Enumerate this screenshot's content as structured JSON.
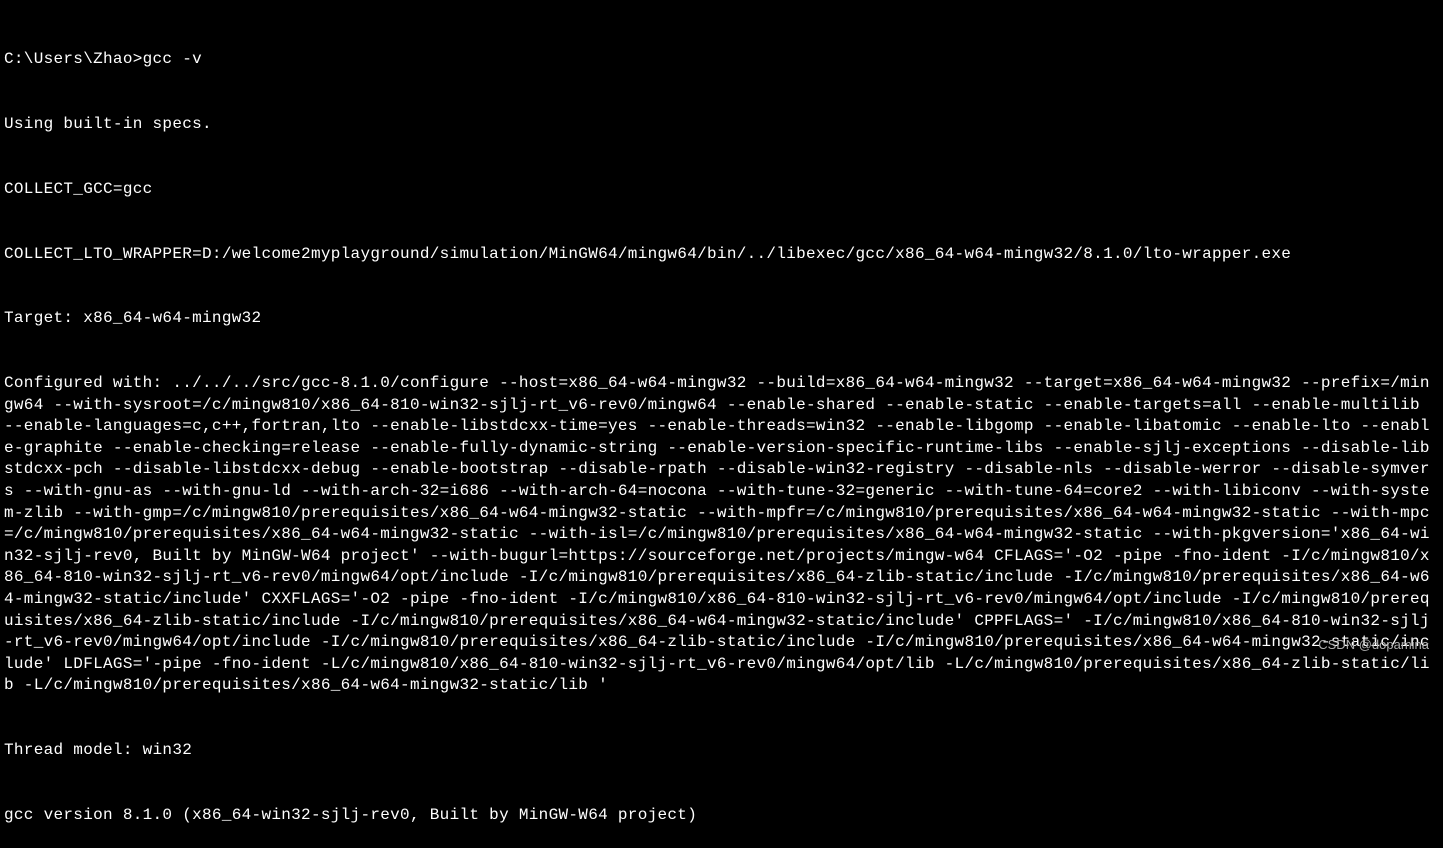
{
  "terminal": {
    "prompt": "C:\\Users\\Zhao>",
    "command": "gcc -v",
    "output_lines": [
      "Using built-in specs.",
      "COLLECT_GCC=gcc",
      "COLLECT_LTO_WRAPPER=D:/welcome2myplayground/simulation/MinGW64/mingw64/bin/../libexec/gcc/x86_64-w64-mingw32/8.1.0/lto-wrapper.exe",
      "Target: x86_64-w64-mingw32",
      "Configured with: ../../../src/gcc-8.1.0/configure --host=x86_64-w64-mingw32 --build=x86_64-w64-mingw32 --target=x86_64-w64-mingw32 --prefix=/mingw64 --with-sysroot=/c/mingw810/x86_64-810-win32-sjlj-rt_v6-rev0/mingw64 --enable-shared --enable-static --enable-targets=all --enable-multilib --enable-languages=c,c++,fortran,lto --enable-libstdcxx-time=yes --enable-threads=win32 --enable-libgomp --enable-libatomic --enable-lto --enable-graphite --enable-checking=release --enable-fully-dynamic-string --enable-version-specific-runtime-libs --enable-sjlj-exceptions --disable-libstdcxx-pch --disable-libstdcxx-debug --enable-bootstrap --disable-rpath --disable-win32-registry --disable-nls --disable-werror --disable-symvers --with-gnu-as --with-gnu-ld --with-arch-32=i686 --with-arch-64=nocona --with-tune-32=generic --with-tune-64=core2 --with-libiconv --with-system-zlib --with-gmp=/c/mingw810/prerequisites/x86_64-w64-mingw32-static --with-mpfr=/c/mingw810/prerequisites/x86_64-w64-mingw32-static --with-mpc=/c/mingw810/prerequisites/x86_64-w64-mingw32-static --with-isl=/c/mingw810/prerequisites/x86_64-w64-mingw32-static --with-pkgversion='x86_64-win32-sjlj-rev0, Built by MinGW-W64 project' --with-bugurl=https://sourceforge.net/projects/mingw-w64 CFLAGS='-O2 -pipe -fno-ident -I/c/mingw810/x86_64-810-win32-sjlj-rt_v6-rev0/mingw64/opt/include -I/c/mingw810/prerequisites/x86_64-zlib-static/include -I/c/mingw810/prerequisites/x86_64-w64-mingw32-static/include' CXXFLAGS='-O2 -pipe -fno-ident -I/c/mingw810/x86_64-810-win32-sjlj-rt_v6-rev0/mingw64/opt/include -I/c/mingw810/prerequisites/x86_64-zlib-static/include -I/c/mingw810/prerequisites/x86_64-w64-mingw32-static/include' CPPFLAGS=' -I/c/mingw810/x86_64-810-win32-sjlj-rt_v6-rev0/mingw64/opt/include -I/c/mingw810/prerequisites/x86_64-zlib-static/include -I/c/mingw810/prerequisites/x86_64-w64-mingw32-static/include' LDFLAGS='-pipe -fno-ident -L/c/mingw810/x86_64-810-win32-sjlj-rt_v6-rev0/mingw64/opt/lib -L/c/mingw810/prerequisites/x86_64-zlib-static/lib -L/c/mingw810/prerequisites/x86_64-w64-mingw32-static/lib '",
      "Thread model: win32",
      "gcc version 8.1.0 (x86_64-win32-sjlj-rev0, Built by MinGW-W64 project)"
    ]
  },
  "watermark": "CSDN @dopamina"
}
